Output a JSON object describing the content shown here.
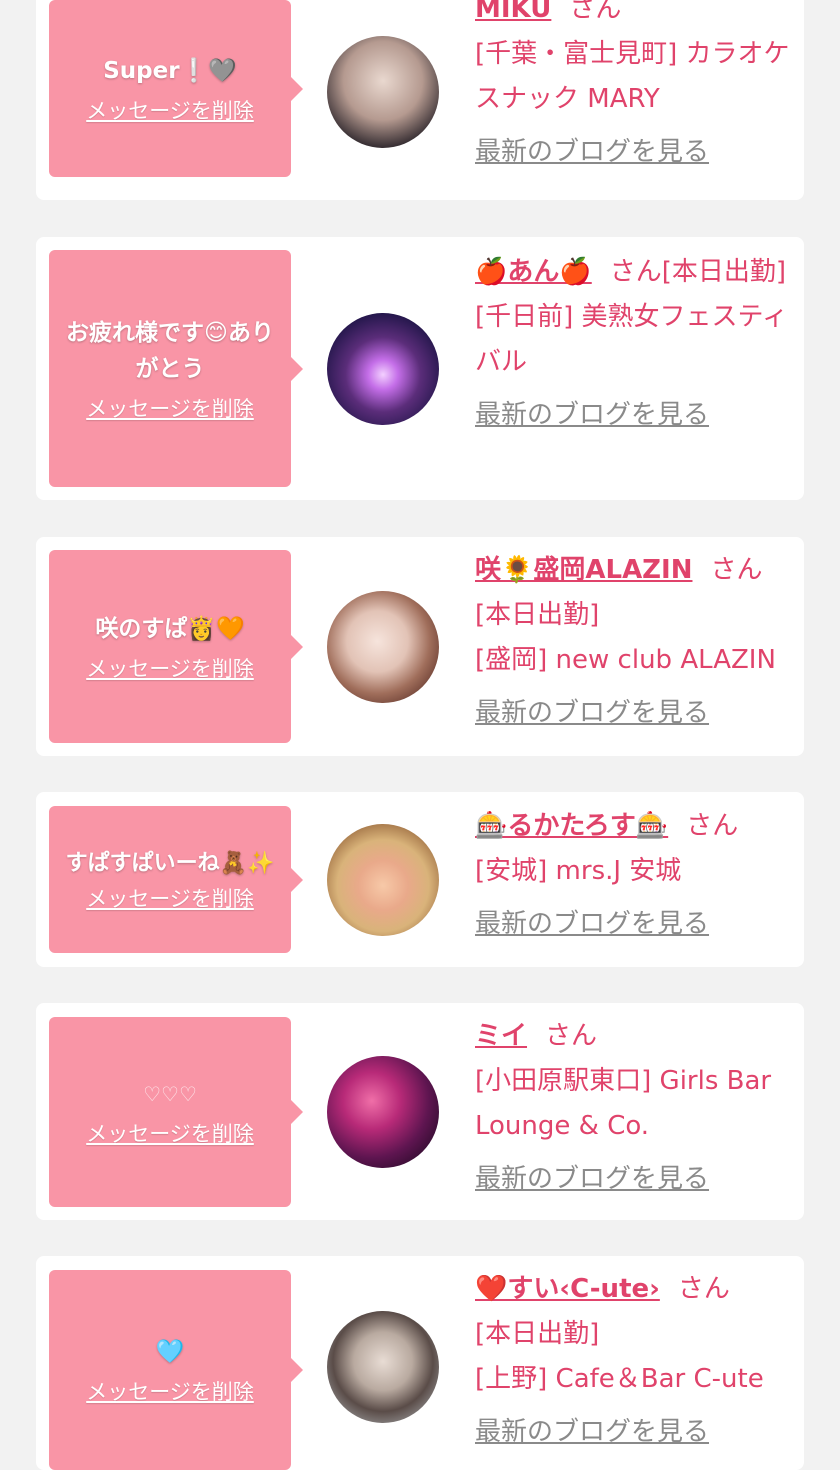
{
  "common": {
    "delete_label": "メッセージを削除",
    "san_label": "さん",
    "blog_label": "最新のブログを見る"
  },
  "items": [
    {
      "message": "Super❕🩶",
      "name": "MIKU",
      "attendance": "",
      "shop": "[千葉・富士見町] カラオケスナック MARY"
    },
    {
      "message": "お疲れ様です😊ありがとう",
      "name": "🍎あん🍎",
      "attendance": "[本日出勤]",
      "shop": "[千日前] 美熟女フェスティバル"
    },
    {
      "message": "咲のすぱ👸🧡",
      "name": "咲🌻盛岡ALAZIN",
      "attendance": "[本日出勤]",
      "shop": "[盛岡] new club ALAZIN"
    },
    {
      "message": "すぱすぱいーね🧸✨",
      "name": "🎰るかたろす🎰",
      "attendance": "",
      "shop": "[安城] mrs.J 安城"
    },
    {
      "message": "♡♡♡",
      "name": "ミイ",
      "attendance": "",
      "shop": "[小田原駅東口] Girls Bar Lounge & Co."
    },
    {
      "message": "🩵",
      "name": "❤️すい‹C-ute›",
      "attendance": "[本日出勤]",
      "shop": "[上野] Cafe＆Bar C-ute"
    }
  ]
}
